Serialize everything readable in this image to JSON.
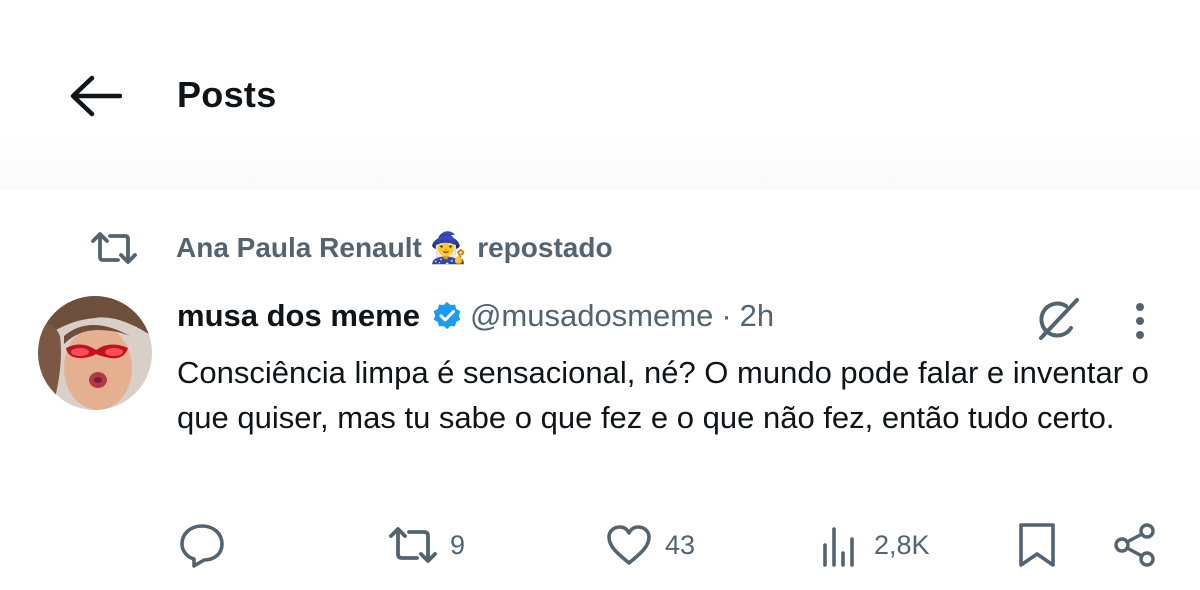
{
  "header": {
    "back_icon": "arrow-left-icon",
    "title": "Posts"
  },
  "repost": {
    "icon": "repost-icon",
    "user": "Ana Paula Renault",
    "emoji": "🧙‍♀️",
    "suffix": "repostado"
  },
  "post": {
    "avatar_icon": "avatar-photo",
    "author_name": "musa dos meme",
    "verified_icon": "verified-badge-icon",
    "verified_color": "#1d9bf0",
    "handle": "@musadosmeme",
    "separator": "·",
    "time": "2h",
    "grok_icon": "grok-icon",
    "more_icon": "more-vertical-icon",
    "text": "Consciência limpa é sensacional, né? O mundo pode falar e inventar o que quiser, mas tu sabe o que fez e o que não fez, então tudo certo."
  },
  "actions": {
    "reply": {
      "icon": "reply-icon",
      "count": ""
    },
    "repost": {
      "icon": "repost-icon",
      "count": "9"
    },
    "like": {
      "icon": "heart-icon",
      "count": "43"
    },
    "views": {
      "icon": "views-chart-icon",
      "count": "2,8K"
    },
    "bookmark": {
      "icon": "bookmark-icon"
    },
    "share": {
      "icon": "share-icon"
    }
  },
  "colors": {
    "text_primary": "#0f1419",
    "text_secondary": "#536471",
    "accent": "#1d9bf0"
  }
}
